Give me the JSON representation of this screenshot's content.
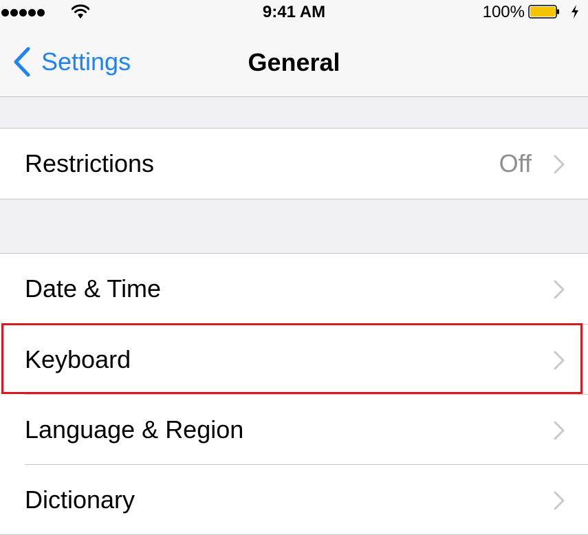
{
  "status_bar": {
    "time": "9:41 AM",
    "battery_percent": "100%",
    "signal_bars": 5,
    "icons": [
      "cellular-signal-icon",
      "wifi-icon",
      "battery-icon",
      "charging-bolt-icon"
    ]
  },
  "nav": {
    "back_label": "Settings",
    "title": "General"
  },
  "groups": [
    {
      "rows": [
        {
          "label": "Restrictions",
          "value": "Off"
        }
      ]
    },
    {
      "rows": [
        {
          "label": "Date & Time",
          "value": ""
        },
        {
          "label": "Keyboard",
          "value": "",
          "highlighted": true
        },
        {
          "label": "Language & Region",
          "value": ""
        },
        {
          "label": "Dictionary",
          "value": ""
        }
      ]
    }
  ],
  "colors": {
    "accent": "#1f83f5",
    "highlight_border": "#d71920",
    "battery_fill": "#f5c400",
    "background": "#efeff4"
  }
}
